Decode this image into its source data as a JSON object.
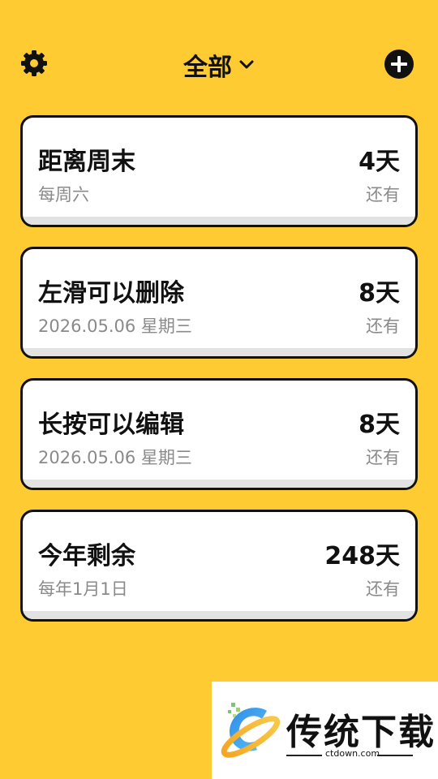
{
  "header": {
    "title": "全部",
    "settings_icon": "gear-icon",
    "dropdown_icon": "chevron-down-icon",
    "add_icon": "plus-circle-icon"
  },
  "cards": [
    {
      "title": "距离周末",
      "subtitle": "每周六",
      "days": "4天",
      "label": "还有"
    },
    {
      "title": "左滑可以删除",
      "subtitle": "2026.05.06 星期三",
      "days": "8天",
      "label": "还有"
    },
    {
      "title": "长按可以编辑",
      "subtitle": "2026.05.06 星期三",
      "days": "8天",
      "label": "还有"
    },
    {
      "title": "今年剩余",
      "subtitle": "每年1月1日",
      "days": "248天",
      "label": "还有"
    }
  ],
  "watermark": {
    "brand": "传统下载",
    "url": "ctdown.com"
  },
  "colors": {
    "background": "#FFCB33",
    "card": "#FFFFFF",
    "border": "#111111",
    "muted_text": "#8A8A8A"
  }
}
